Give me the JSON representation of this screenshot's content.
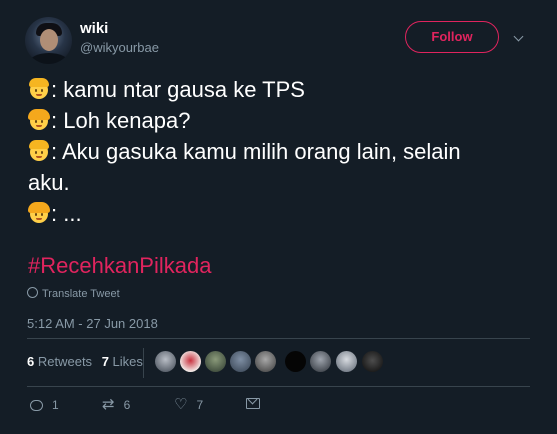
{
  "author": {
    "name": "wiki",
    "handle": "@wikyourbae"
  },
  "follow_label": "Follow",
  "tweet_lines": [
    {
      "emoji": "boy-emoji",
      "text": ": kamu ntar gausa ke TPS"
    },
    {
      "emoji": "girl-emoji",
      "text": ": Loh kenapa?"
    },
    {
      "emoji": "boy-emoji",
      "text": ": Aku gasuka kamu milih orang lain, selain"
    },
    {
      "emoji": "",
      "text": "aku."
    },
    {
      "emoji": "girl-emoji",
      "text": ": ..."
    }
  ],
  "hashtag": "#RecehkanPilkada",
  "translate_label": "Translate Tweet",
  "timestamp": "5:12 AM - 27 Jun 2018",
  "stats": {
    "retweets_count": "6",
    "retweets_label": "Retweets",
    "likes_count": "7",
    "likes_label": "Likes"
  },
  "liker_avatar_count": 10,
  "actions": {
    "replies": "1",
    "retweets": "6",
    "likes": "7"
  },
  "colors": {
    "background": "#141d26",
    "accent": "#e0245e",
    "muted": "#8899a6",
    "divider": "#38444d"
  }
}
